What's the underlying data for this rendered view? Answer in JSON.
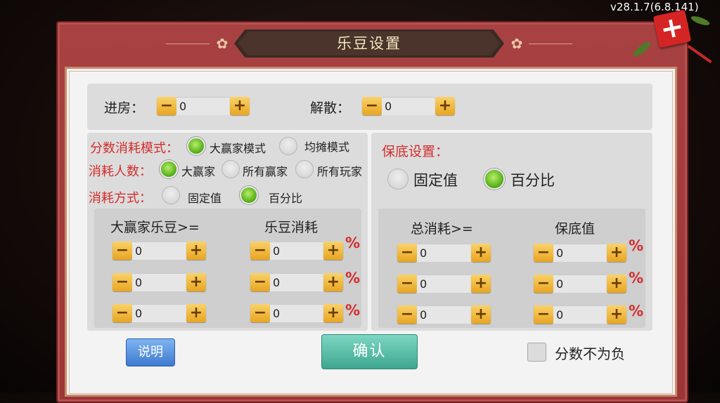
{
  "version": "v28.1.7(6.8.141)",
  "title": "乐豆设置",
  "close_glyph": "+",
  "top_row": {
    "enter": {
      "label": "进房：",
      "value": "0"
    },
    "dissolve": {
      "label": "解散：",
      "value": "0"
    }
  },
  "left": {
    "mode": {
      "label": "分数消耗模式：",
      "options": [
        "大赢家模式",
        "均摊模式"
      ],
      "selected": "大赢家模式"
    },
    "people": {
      "label": "消耗人数：",
      "options": [
        "大赢家",
        "所有赢家",
        "所有玩家"
      ],
      "selected": "大赢家"
    },
    "method": {
      "label": "消耗方式：",
      "options": [
        "固定值",
        "百分比"
      ],
      "selected": "百分比"
    },
    "headers": [
      "大赢家乐豆>=",
      "乐豆消耗"
    ],
    "rows": [
      {
        "threshold": "0",
        "cost": "0"
      },
      {
        "threshold": "0",
        "cost": "0"
      },
      {
        "threshold": "0",
        "cost": "0"
      }
    ]
  },
  "right": {
    "label": "保底设置：",
    "options": [
      "固定值",
      "百分比"
    ],
    "selected": "百分比",
    "headers": [
      "总消耗>=",
      "保底值"
    ],
    "rows": [
      {
        "total": "0",
        "min": "0"
      },
      {
        "total": "0",
        "min": "0"
      },
      {
        "total": "0",
        "min": "0"
      }
    ]
  },
  "percent_symbol": "%",
  "stepper": {
    "minus": "−",
    "plus": "+"
  },
  "footer": {
    "help": "说明",
    "confirm": "确认",
    "nonneg_label": "分数不为负",
    "nonneg_checked": false
  },
  "colors": {
    "accent_red": "#d42c2c",
    "frame": "#a63c3c",
    "radio_on": "#5fbf1a",
    "stepper": "#f0b73a"
  }
}
